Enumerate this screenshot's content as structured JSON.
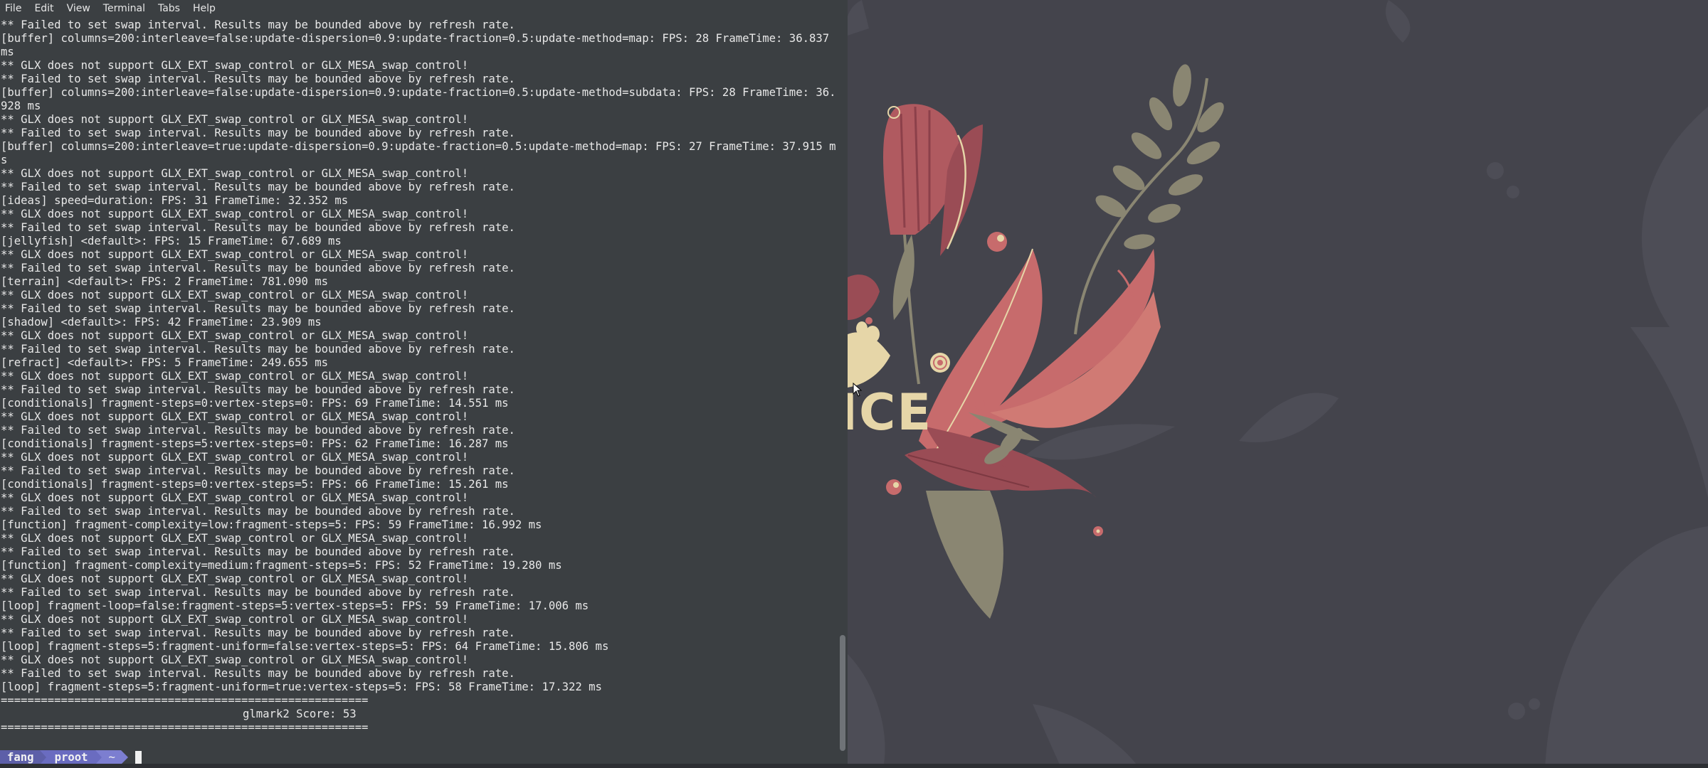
{
  "menu": [
    "File",
    "Edit",
    "View",
    "Terminal",
    "Tabs",
    "Help"
  ],
  "output_lines": [
    "** Failed to set swap interval. Results may be bounded above by refresh rate.",
    "[buffer] columns=200:interleave=false:update-dispersion=0.9:update-fraction=0.5:update-method=map: FPS: 28 FrameTime: 36.837 ms",
    "** GLX does not support GLX_EXT_swap_control or GLX_MESA_swap_control!",
    "** Failed to set swap interval. Results may be bounded above by refresh rate.",
    "[buffer] columns=200:interleave=false:update-dispersion=0.9:update-fraction=0.5:update-method=subdata: FPS: 28 FrameTime: 36.928 ms",
    "** GLX does not support GLX_EXT_swap_control or GLX_MESA_swap_control!",
    "** Failed to set swap interval. Results may be bounded above by refresh rate.",
    "[buffer] columns=200:interleave=true:update-dispersion=0.9:update-fraction=0.5:update-method=map: FPS: 27 FrameTime: 37.915 ms",
    "** GLX does not support GLX_EXT_swap_control or GLX_MESA_swap_control!",
    "** Failed to set swap interval. Results may be bounded above by refresh rate.",
    "[ideas] speed=duration: FPS: 31 FrameTime: 32.352 ms",
    "** GLX does not support GLX_EXT_swap_control or GLX_MESA_swap_control!",
    "** Failed to set swap interval. Results may be bounded above by refresh rate.",
    "[jellyfish] <default>: FPS: 15 FrameTime: 67.689 ms",
    "** GLX does not support GLX_EXT_swap_control or GLX_MESA_swap_control!",
    "** Failed to set swap interval. Results may be bounded above by refresh rate.",
    "[terrain] <default>: FPS: 2 FrameTime: 781.090 ms",
    "** GLX does not support GLX_EXT_swap_control or GLX_MESA_swap_control!",
    "** Failed to set swap interval. Results may be bounded above by refresh rate.",
    "[shadow] <default>: FPS: 42 FrameTime: 23.909 ms",
    "** GLX does not support GLX_EXT_swap_control or GLX_MESA_swap_control!",
    "** Failed to set swap interval. Results may be bounded above by refresh rate.",
    "[refract] <default>: FPS: 5 FrameTime: 249.655 ms",
    "** GLX does not support GLX_EXT_swap_control or GLX_MESA_swap_control!",
    "** Failed to set swap interval. Results may be bounded above by refresh rate.",
    "[conditionals] fragment-steps=0:vertex-steps=0: FPS: 69 FrameTime: 14.551 ms",
    "** GLX does not support GLX_EXT_swap_control or GLX_MESA_swap_control!",
    "** Failed to set swap interval. Results may be bounded above by refresh rate.",
    "[conditionals] fragment-steps=5:vertex-steps=0: FPS: 62 FrameTime: 16.287 ms",
    "** GLX does not support GLX_EXT_swap_control or GLX_MESA_swap_control!",
    "** Failed to set swap interval. Results may be bounded above by refresh rate.",
    "[conditionals] fragment-steps=0:vertex-steps=5: FPS: 66 FrameTime: 15.261 ms",
    "** GLX does not support GLX_EXT_swap_control or GLX_MESA_swap_control!",
    "** Failed to set swap interval. Results may be bounded above by refresh rate.",
    "[function] fragment-complexity=low:fragment-steps=5: FPS: 59 FrameTime: 16.992 ms",
    "** GLX does not support GLX_EXT_swap_control or GLX_MESA_swap_control!",
    "** Failed to set swap interval. Results may be bounded above by refresh rate.",
    "[function] fragment-complexity=medium:fragment-steps=5: FPS: 52 FrameTime: 19.280 ms",
    "** GLX does not support GLX_EXT_swap_control or GLX_MESA_swap_control!",
    "** Failed to set swap interval. Results may be bounded above by refresh rate.",
    "[loop] fragment-loop=false:fragment-steps=5:vertex-steps=5: FPS: 59 FrameTime: 17.006 ms",
    "** GLX does not support GLX_EXT_swap_control or GLX_MESA_swap_control!",
    "** Failed to set swap interval. Results may be bounded above by refresh rate.",
    "[loop] fragment-steps=5:fragment-uniform=false:vertex-steps=5: FPS: 64 FrameTime: 15.806 ms",
    "** GLX does not support GLX_EXT_swap_control or GLX_MESA_swap_control!",
    "** Failed to set swap interval. Results may be bounded above by refresh rate.",
    "[loop] fragment-steps=5:fragment-uniform=true:vertex-steps=5: FPS: 58 FrameTime: 17.322 ms",
    "=======================================================",
    "glmark2 Score: 53",
    "=======================================================",
    ""
  ],
  "prompt": {
    "user": "fang",
    "host": "proot",
    "dir": "~"
  },
  "wallpaper_text": "ICE",
  "colors": {
    "terminal_bg": "#3b3f42",
    "terminal_fg": "#e8e8e8",
    "desktop_bg": "#44444c",
    "leaf_red": "#c76b6c",
    "leaf_dark_red": "#9a4c55",
    "leaf_olive": "#8a8672",
    "cream": "#e6d6a8"
  }
}
